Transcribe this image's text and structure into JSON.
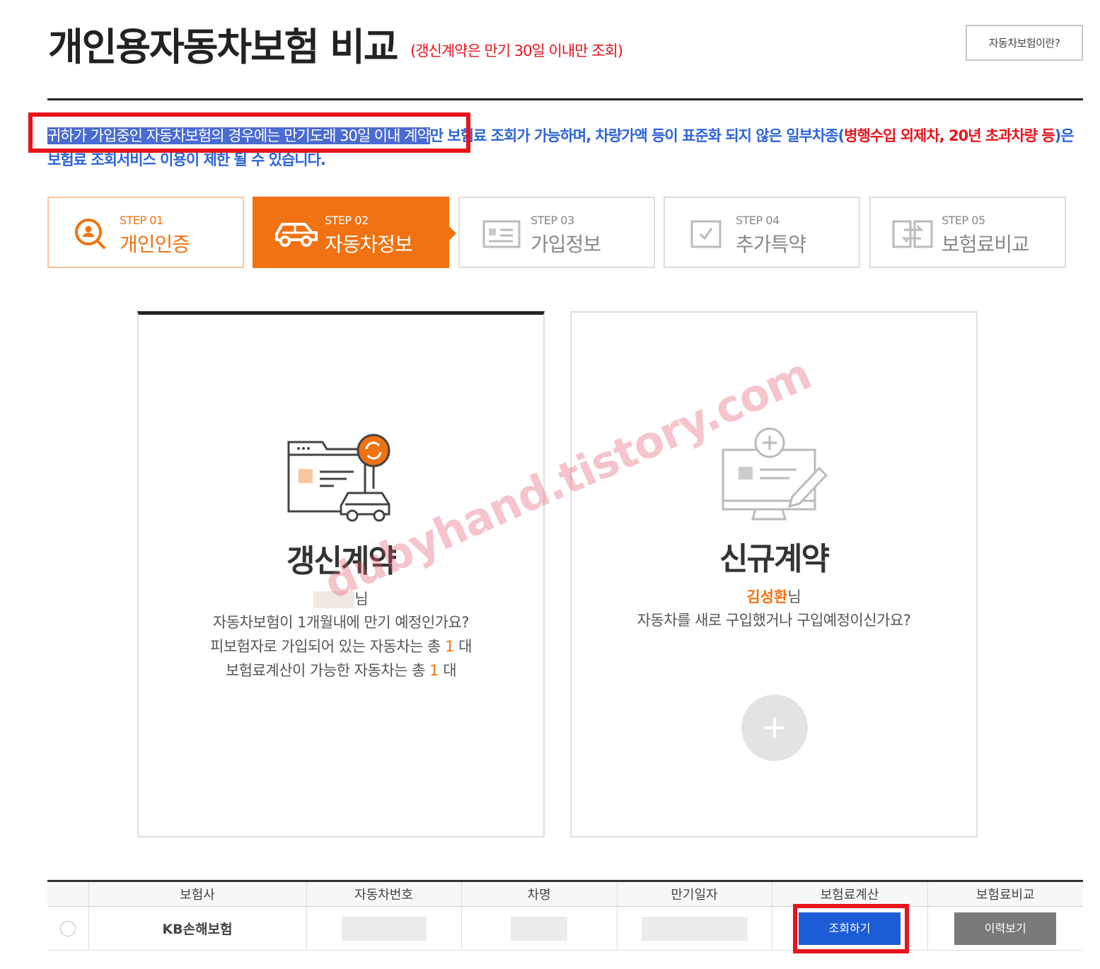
{
  "header": {
    "title": "개인용자동차보험 비교",
    "subtitle": "(갱신계약은 만기 30일 이내만 조회)",
    "about_button": "자동차보험이란?"
  },
  "notice": {
    "highlighted": "귀하가 가입중인 자동차보험의 경우에는 만기도래 30일 이내 계약",
    "text1": "만 보험료 조회가 가능하며, 차량가액 등이 표준화 되지 않은 일부차종(",
    "red": "병행수입 외제차, 20년 초과차량 등",
    "text2": ")은 보험료 조회서비스 이용이 제한 될 수 있습니다."
  },
  "steps": [
    {
      "num": "STEP 01",
      "name": "개인인증",
      "icon": "user-search-icon",
      "state": "done"
    },
    {
      "num": "STEP 02",
      "name": "자동차정보",
      "icon": "car-icon",
      "state": "active"
    },
    {
      "num": "STEP 03",
      "name": "가입정보",
      "icon": "id-card-icon",
      "state": "todo"
    },
    {
      "num": "STEP 04",
      "name": "추가특약",
      "icon": "checkbox-icon",
      "state": "todo"
    },
    {
      "num": "STEP 05",
      "name": "보험료비교",
      "icon": "compare-icon",
      "state": "todo"
    }
  ],
  "renew_card": {
    "title": "갱신계약",
    "name_suffix": "님",
    "line1": "자동차보험이 1개월내에 만기 예정인가요?",
    "line2_prefix": "피보험자로 가입되어 있는 자동차는 총",
    "line2_count": "1",
    "line2_unit": "대",
    "line3_prefix": "보험료계산이 가능한 자동차는 총",
    "line3_count": "1",
    "line3_unit": "대"
  },
  "new_card": {
    "title": "신규계약",
    "name": "김성환",
    "name_suffix": "님",
    "line1": "자동차를 새로 구입했거나 구입예정이신가요?"
  },
  "watermark": "dubyhand.tistory.com",
  "table": {
    "headers": [
      "보험사",
      "자동차번호",
      "차명",
      "만기일자",
      "보험료계산",
      "보험료비교"
    ],
    "row": {
      "insurer": "KB손해보험",
      "calc_button": "조회하기",
      "history_button": "이력보기"
    }
  },
  "colors": {
    "accent": "#f07212",
    "notice_blue": "#2d63d9",
    "alert_red": "#e8141c",
    "button_blue": "#1c5cd6"
  }
}
